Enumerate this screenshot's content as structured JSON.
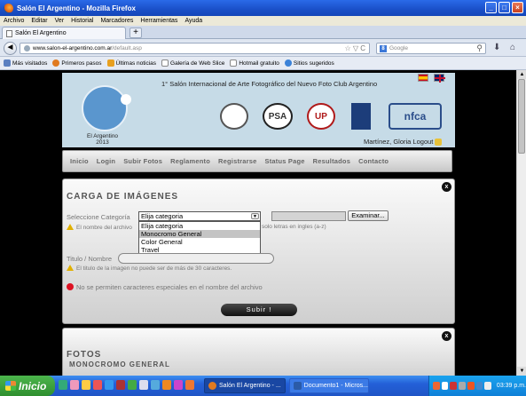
{
  "window": {
    "title": "Salón El Argentino - Mozilla Firefox",
    "buttons": {
      "minimize": "_",
      "maximize": "□",
      "close": "×"
    }
  },
  "menu": [
    "Archivo",
    "Editar",
    "Ver",
    "Historial",
    "Marcadores",
    "Herramientas",
    "Ayuda"
  ],
  "tab": {
    "label": "Salón El Argentino",
    "new_tab": "+"
  },
  "nav": {
    "back": "◄",
    "url_host": "www.salon-el-argentino.com.ar",
    "url_path": "/default.asp",
    "url_icons": "☆ ▽ C",
    "search_engine": "8",
    "search_placeholder": "Google",
    "search_icon": "⚲",
    "download_icon": "⬇",
    "home_icon": "⌂"
  },
  "bookmarks": [
    {
      "label": "Más visitados",
      "icon": "bookmark-icon",
      "color": "#5a7fc0"
    },
    {
      "label": "Primeros pasos",
      "icon": "firefox-icon",
      "color": "#e07a20"
    },
    {
      "label": "Últimas noticias",
      "icon": "rss-icon",
      "color": "#e8a020"
    },
    {
      "label": "Galería de Web Slice",
      "icon": "page-icon",
      "color": "#ffffff"
    },
    {
      "label": "Hotmail gratuito",
      "icon": "page-icon",
      "color": "#ffffff"
    },
    {
      "label": "Sitios sugeridos",
      "icon": "ie-icon",
      "color": "#3b82d8"
    }
  ],
  "site": {
    "header_title": "1° Salón Internacional de Arte Fotográfico del Nuevo Foto Club Argentino",
    "club_name": "El Argentino",
    "club_year": "2013",
    "sponsors": [
      "",
      "PSA",
      "UP",
      "",
      "nfca"
    ],
    "user": "Martínez, Gloria Logout",
    "nav": [
      "Inicio",
      "Login",
      "Subir Fotos",
      "Reglamento",
      "Registrarse",
      "Status Page",
      "Resultados",
      "Contacto"
    ],
    "nav_sep": "|"
  },
  "upload": {
    "heading": "CARGA DE IMÁGENES",
    "close": "x",
    "category_label": "Seleccione Categoría",
    "category_value": "Elija categoria",
    "category_options": [
      "Elija categoria",
      "Monocromo General",
      "Color General",
      "Travel"
    ],
    "selected_option_index": 1,
    "browse_button": "Examinar...",
    "filename_warning_start": "El nombre del archivo",
    "filename_warning_end": "solo letras en ingles (a-z)",
    "title_label": "Titulo / Nombre",
    "title_warning": "El titulo de la imagen no puede ser de más de 30 caracteres.",
    "error_message": "No se permiten caracteres especiales en el nombre del archivo",
    "submit_button": "Subir !"
  },
  "photos": {
    "heading": "FOTOS",
    "subheading": "MONOCROMO GENERAL",
    "close": "x"
  },
  "taskbar": {
    "start": "Inicio",
    "tasks": [
      {
        "label": "Salón El Argentino - ...",
        "active": true
      },
      {
        "label": "Documento1 - Micros...",
        "active": false
      }
    ],
    "clock": "03:39 p.m."
  }
}
